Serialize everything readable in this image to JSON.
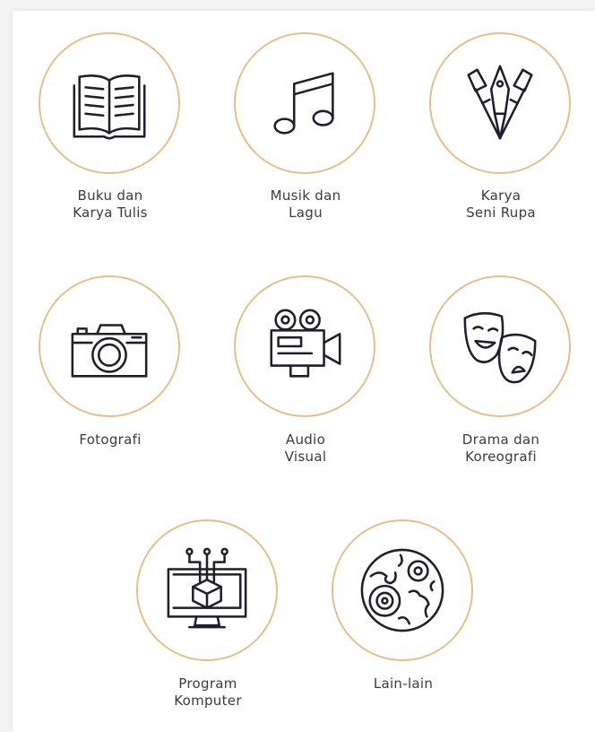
{
  "categories": [
    {
      "id": "buku",
      "line1": "Buku dan",
      "line2": "Karya Tulis",
      "icon": "open-book-icon"
    },
    {
      "id": "musik",
      "line1": "Musik dan",
      "line2": "Lagu",
      "icon": "music-note-icon"
    },
    {
      "id": "seni-rupa",
      "line1": "Karya",
      "line2": "Seni Rupa",
      "icon": "art-tools-icon"
    },
    {
      "id": "fotografi",
      "line1": "Fotografi",
      "line2": "",
      "icon": "camera-icon"
    },
    {
      "id": "audio-visual",
      "line1": "Audio",
      "line2": "Visual",
      "icon": "video-camera-icon"
    },
    {
      "id": "drama",
      "line1": "Drama dan",
      "line2": "Koreografi",
      "icon": "theater-masks-icon"
    },
    {
      "id": "program",
      "line1": "Program",
      "line2": "Komputer",
      "icon": "computer-program-icon"
    },
    {
      "id": "lain",
      "line1": "Lain-lain",
      "line2": "",
      "icon": "misc-circle-icon"
    }
  ],
  "accent_color": "#e2c08d",
  "icon_color": "#1f1f2b"
}
